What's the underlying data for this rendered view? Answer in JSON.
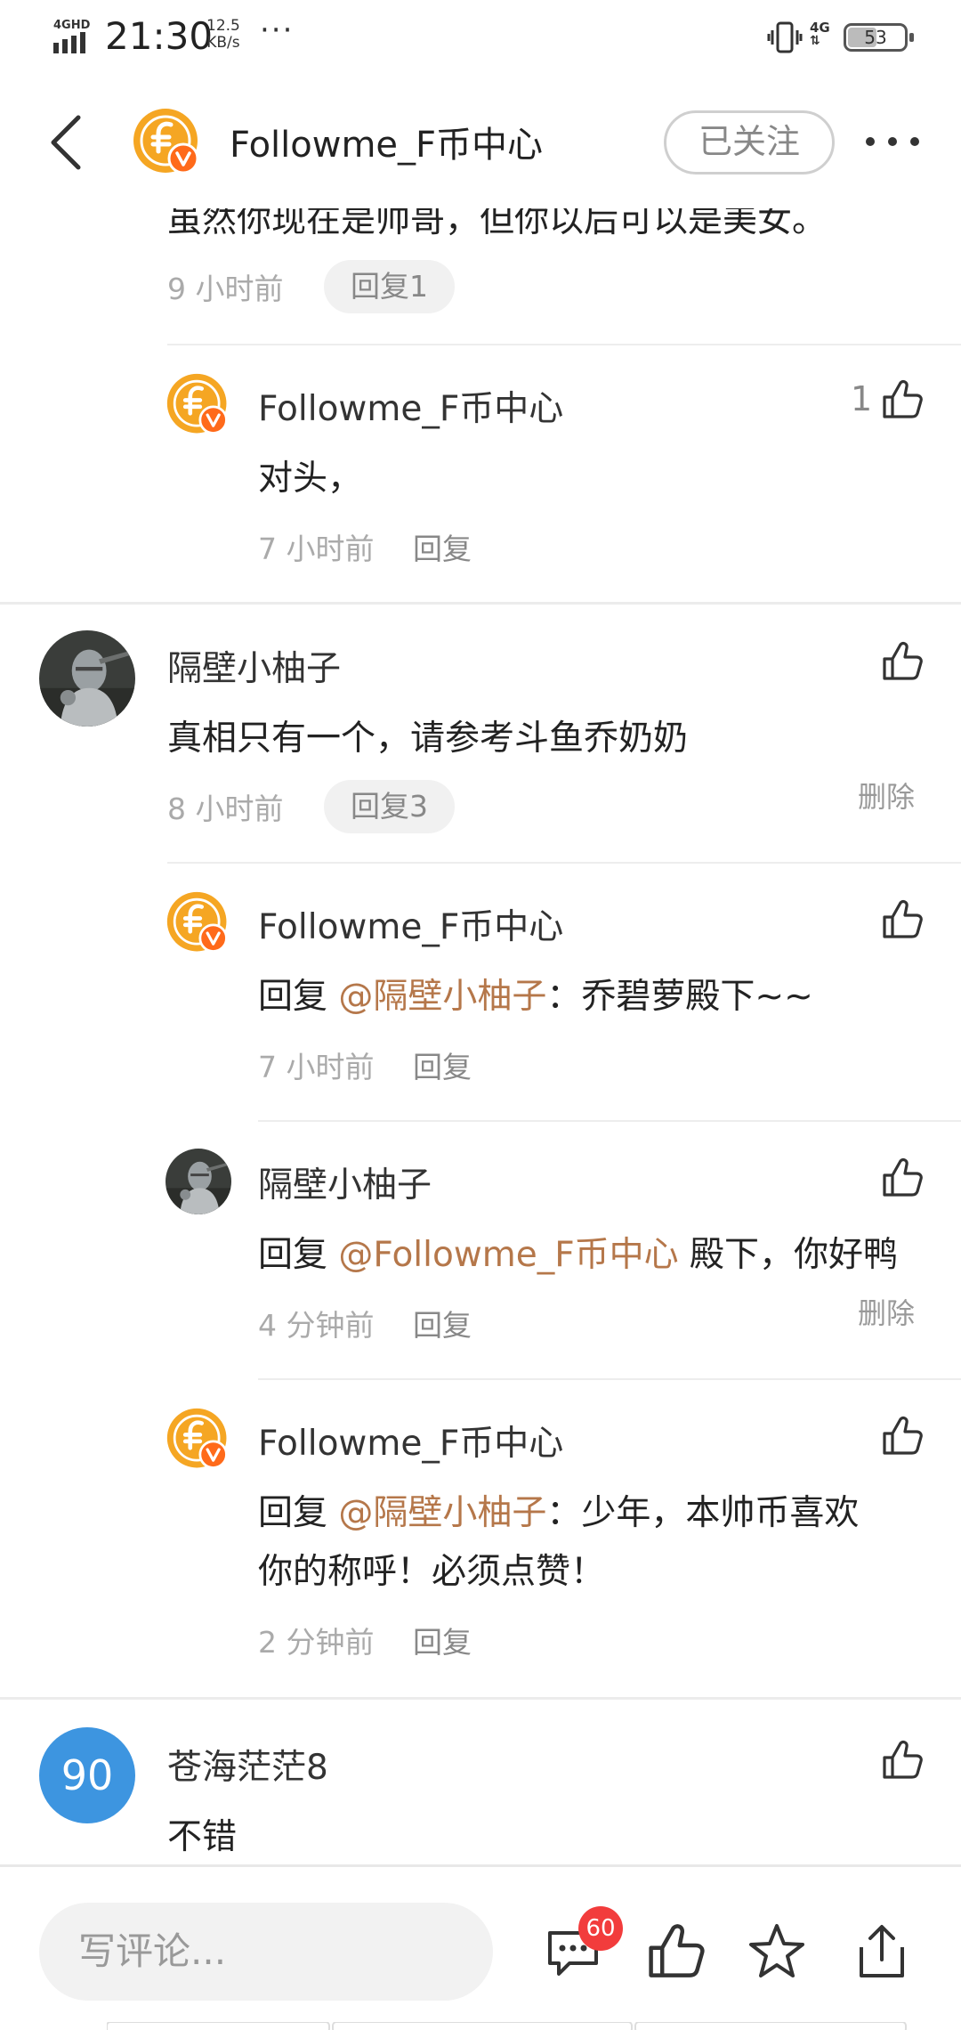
{
  "status_bar": {
    "network": "4GHD",
    "time": "21:30",
    "speed_value": "12.5",
    "speed_unit": "KB/s",
    "more": "···",
    "network_right": "4G",
    "battery": "53",
    "battery_level": 0.53
  },
  "header": {
    "title": "Followme_F币中心",
    "follow_label": "已关注"
  },
  "comments": {
    "c0": {
      "text": "虽然你现在是帅哥，但你以后可以是美女。",
      "time": "9 小时前",
      "reply_label": "回复1"
    },
    "r0": {
      "name": "Followme_F币中心",
      "text": "对头，",
      "time": "7 小时前",
      "reply_label": "回复",
      "likes": "1"
    },
    "c1": {
      "name": "隔壁小柚子",
      "text": "真相只有一个，请参考斗鱼乔奶奶",
      "time": "8 小时前",
      "reply_label": "回复3",
      "delete_label": "删除"
    },
    "r1": {
      "name": "Followme_F币中心",
      "prefix": "回复 ",
      "mention": "@隔壁小柚子",
      "text": "：乔碧萝殿下~~",
      "time": "7 小时前",
      "reply_label": "回复"
    },
    "r2": {
      "name": "隔壁小柚子",
      "prefix": "回复 ",
      "mention": "@Followme_F币中心",
      "text": " 殿下，你好鸭",
      "time": "4 分钟前",
      "reply_label": "回复",
      "delete_label": "删除"
    },
    "r3": {
      "name": "Followme_F币中心",
      "prefix": "回复 ",
      "mention": "@隔壁小柚子",
      "text_line1": "：少年，本帅币喜欢",
      "text_line2": "你的称呼！必须点赞！",
      "time": "2 分钟前",
      "reply_label": "回复"
    },
    "c2": {
      "avatar_text": "90",
      "name": "苍海茫茫8",
      "text": "不错"
    }
  },
  "bottom_bar": {
    "input_placeholder": "写评论...",
    "comment_badge": "60"
  },
  "icons": {
    "back": "chevron-left-icon",
    "more": "more-dots-icon",
    "like": "thumbs-up-icon",
    "comments": "comment-bubble-icon",
    "star": "star-icon",
    "share": "share-icon"
  },
  "colors": {
    "mention": "#b5774a",
    "coin_orange": "#f5a623",
    "verified_badge": "#ff6a1a",
    "badge_red": "#f23c3c",
    "number_avatar": "#3d95e0"
  }
}
